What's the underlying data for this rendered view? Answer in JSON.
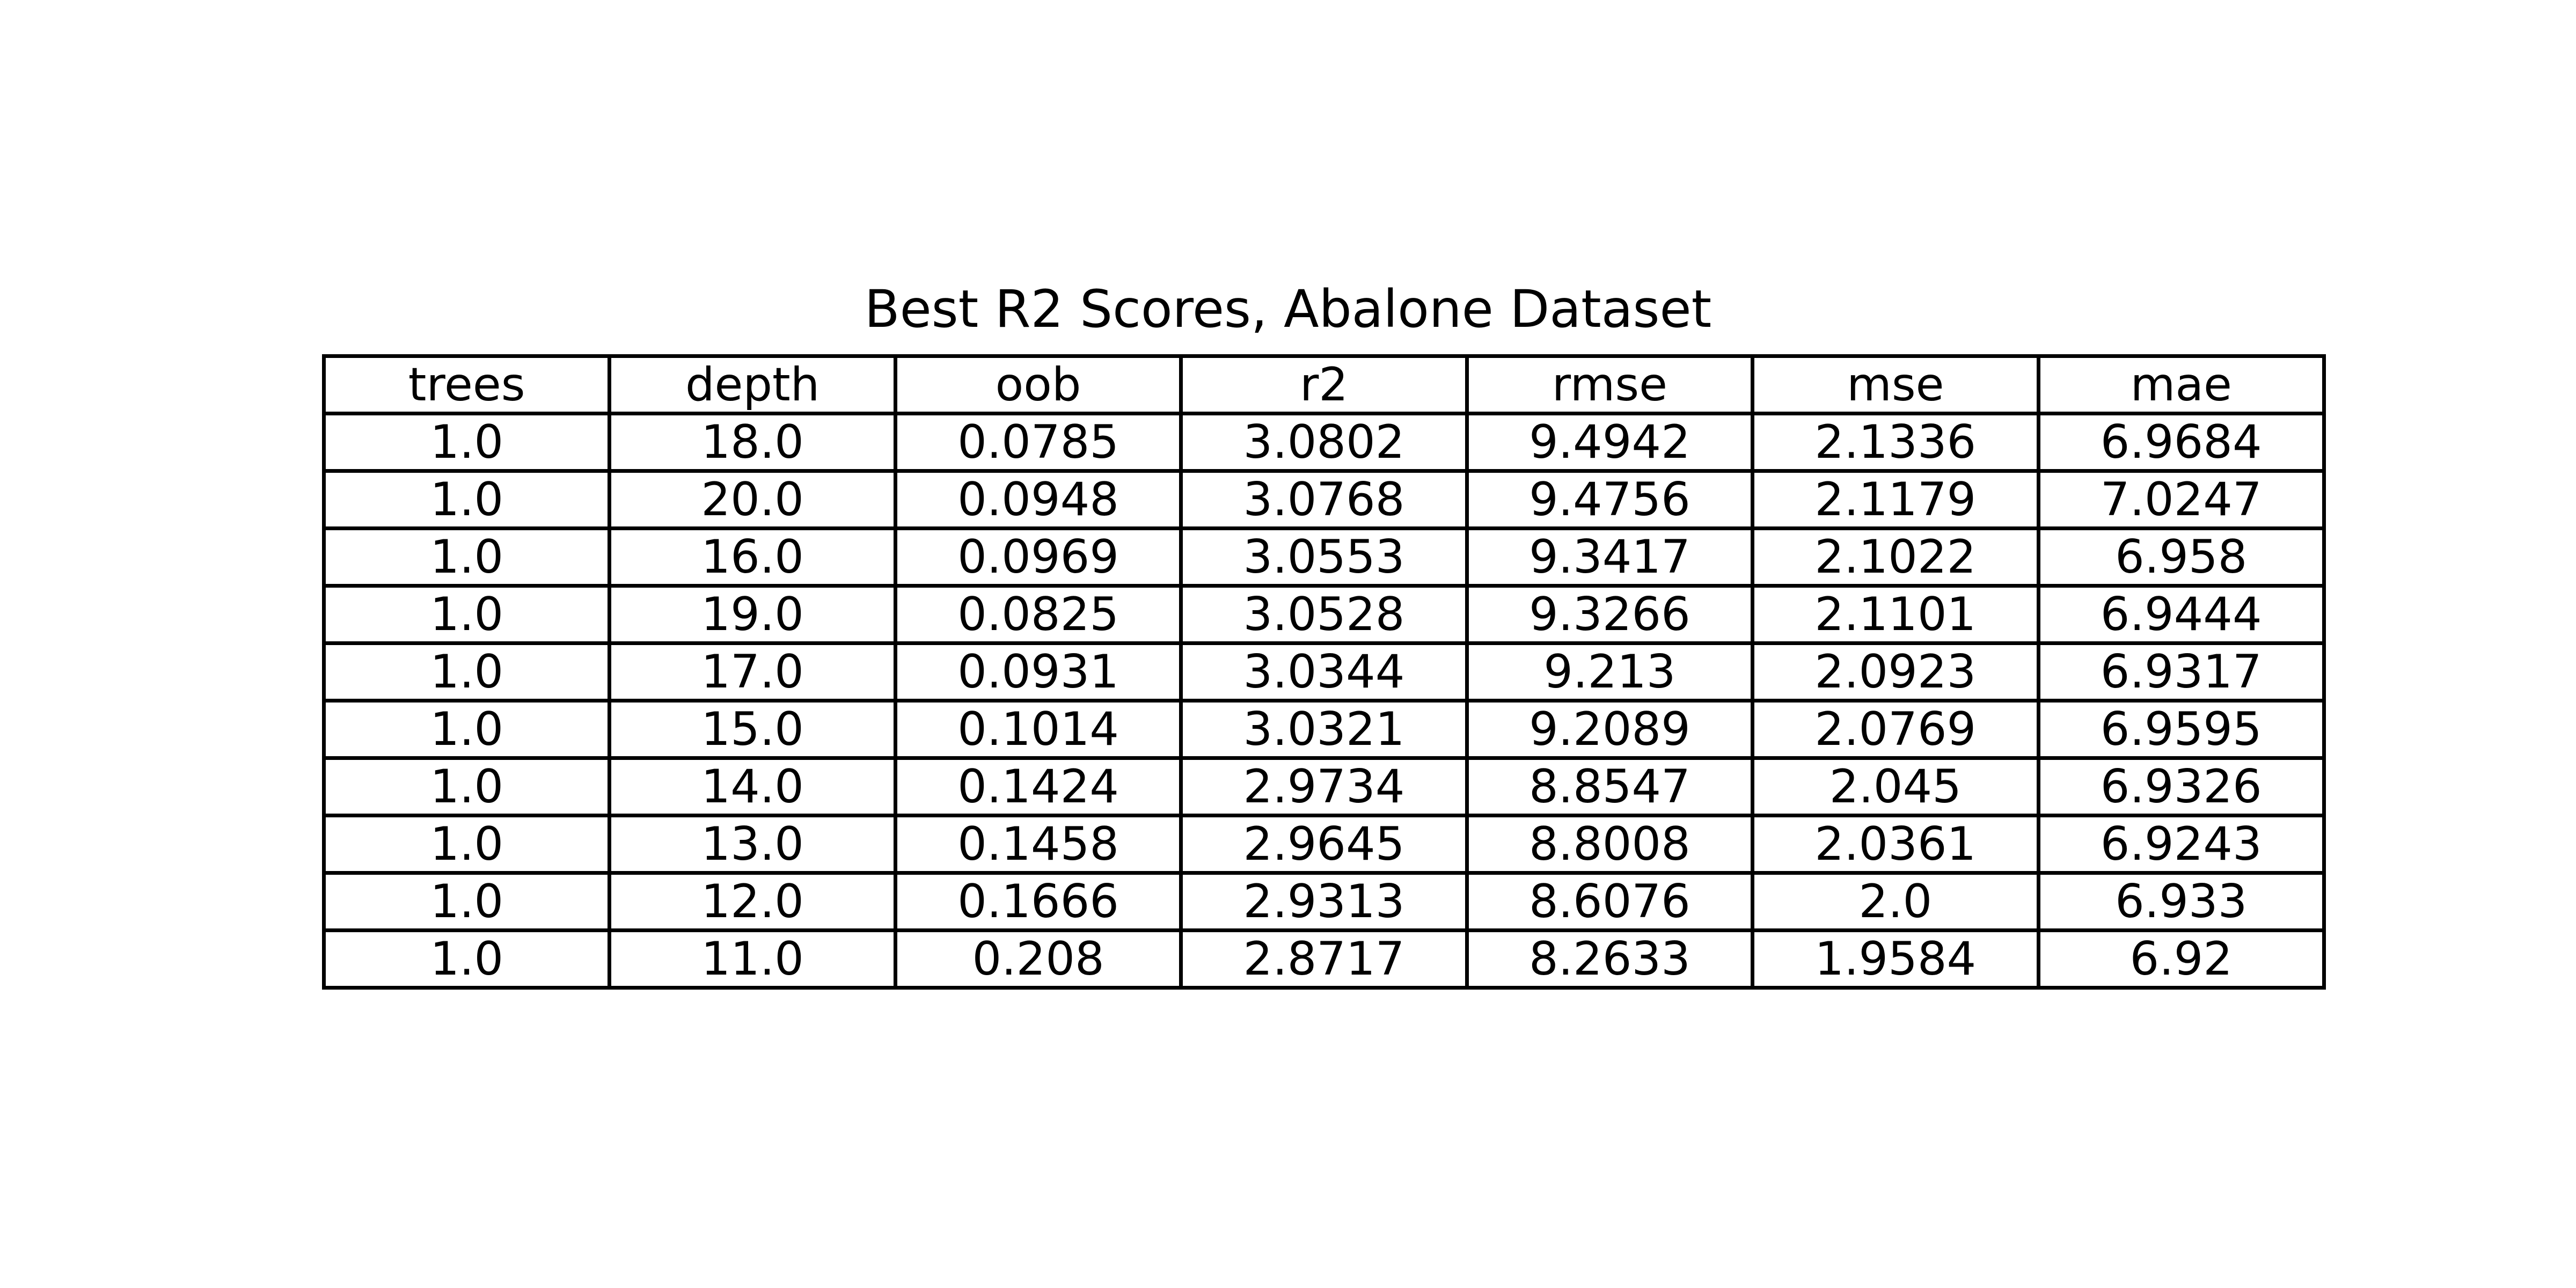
{
  "chart_data": {
    "type": "table",
    "title": "Best R2 Scores, Abalone Dataset",
    "columns": [
      "trees",
      "depth",
      "oob",
      "r2",
      "rmse",
      "mse",
      "mae"
    ],
    "rows": [
      [
        "1.0",
        "18.0",
        "0.0785",
        "3.0802",
        "9.4942",
        "2.1336",
        "6.9684"
      ],
      [
        "1.0",
        "20.0",
        "0.0948",
        "3.0768",
        "9.4756",
        "2.1179",
        "7.0247"
      ],
      [
        "1.0",
        "16.0",
        "0.0969",
        "3.0553",
        "9.3417",
        "2.1022",
        "6.958"
      ],
      [
        "1.0",
        "19.0",
        "0.0825",
        "3.0528",
        "9.3266",
        "2.1101",
        "6.9444"
      ],
      [
        "1.0",
        "17.0",
        "0.0931",
        "3.0344",
        "9.213",
        "2.0923",
        "6.9317"
      ],
      [
        "1.0",
        "15.0",
        "0.1014",
        "3.0321",
        "9.2089",
        "2.0769",
        "6.9595"
      ],
      [
        "1.0",
        "14.0",
        "0.1424",
        "2.9734",
        "8.8547",
        "2.045",
        "6.9326"
      ],
      [
        "1.0",
        "13.0",
        "0.1458",
        "2.9645",
        "8.8008",
        "2.0361",
        "6.9243"
      ],
      [
        "1.0",
        "12.0",
        "0.1666",
        "2.9313",
        "8.6076",
        "2.0",
        "6.933"
      ],
      [
        "1.0",
        "11.0",
        "0.208",
        "2.8717",
        "8.2633",
        "1.9584",
        "6.92"
      ]
    ],
    "grid": true
  }
}
